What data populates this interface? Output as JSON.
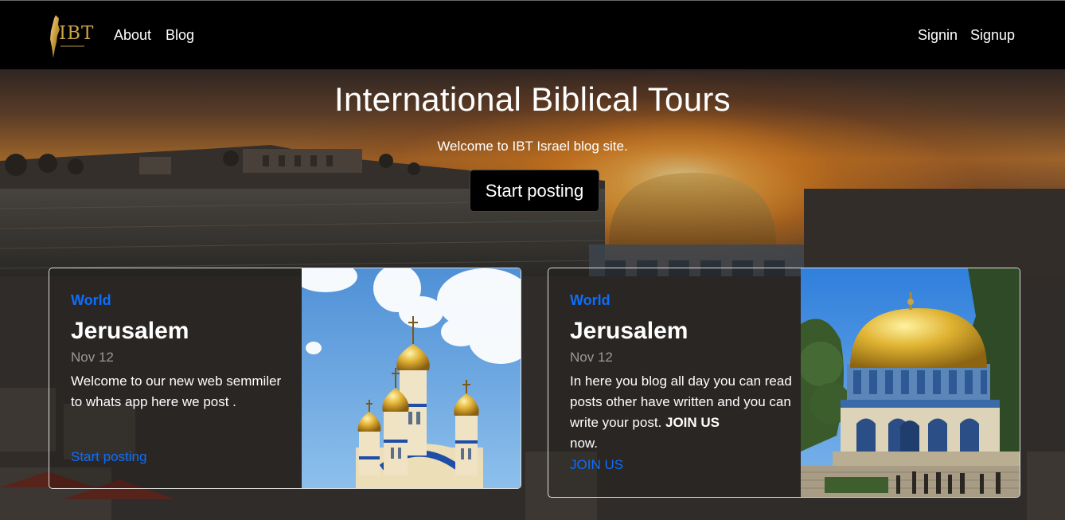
{
  "nav": {
    "brand_text": "IBT",
    "links": [
      {
        "label": "About"
      },
      {
        "label": "Blog"
      }
    ],
    "auth": [
      {
        "label": "Signin"
      },
      {
        "label": "Signup"
      }
    ]
  },
  "hero": {
    "title": "International Biblical Tours",
    "subtitle": "Welcome to IBT Israel blog site.",
    "cta_label": "Start posting"
  },
  "cards": [
    {
      "category": "World",
      "title": "Jerusalem",
      "date": "Nov 12",
      "text": "Welcome to our new web semmiler to whats app here we post .",
      "link_label": "Start posting",
      "image": "russian-orthodox-church-golden-domes"
    },
    {
      "category": "World",
      "title": "Jerusalem",
      "date": "Nov 12",
      "text_before": "In here you blog all day you can read posts other have written and you can write your post.",
      "text_bold": "JOIN US",
      "text_after": "now.",
      "link_label": "JOIN US",
      "image": "dome-of-the-rock"
    }
  ],
  "colors": {
    "navbar_bg": "#000000",
    "accent_link": "#0d6efd",
    "brand_gold": "#c9a449",
    "date_gray": "#9a9a9a"
  }
}
